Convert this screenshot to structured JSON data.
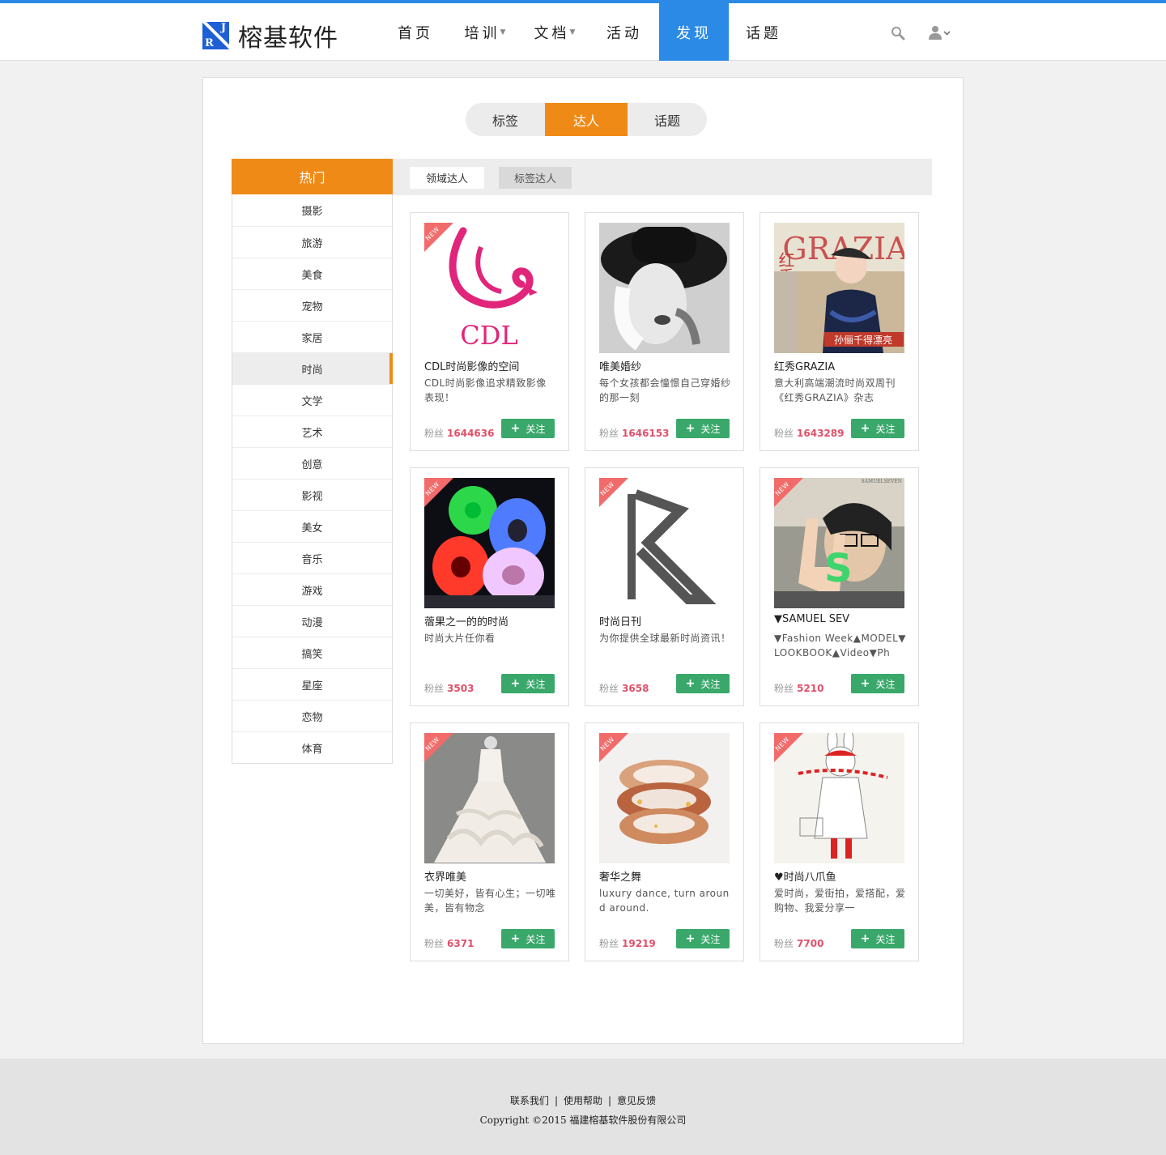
{
  "brand": {
    "name": "榕基软件",
    "mark_r": "R",
    "mark_j": "J"
  },
  "nav": [
    {
      "label": "首页",
      "dropdown": false
    },
    {
      "label": "培训",
      "dropdown": true
    },
    {
      "label": "文档",
      "dropdown": true
    },
    {
      "label": "活动",
      "dropdown": false
    },
    {
      "label": "发现",
      "dropdown": false,
      "active": true
    },
    {
      "label": "话题",
      "dropdown": false
    }
  ],
  "segment_tabs": [
    "标签",
    "达人",
    "话题"
  ],
  "segment_active": "达人",
  "sidebar": {
    "header": "热门",
    "items": [
      "摄影",
      "旅游",
      "美食",
      "宠物",
      "家居",
      "时尚",
      "文学",
      "艺术",
      "创意",
      "影视",
      "美女",
      "音乐",
      "游戏",
      "动漫",
      "搞笑",
      "星座",
      "恋物",
      "体育"
    ],
    "active": "时尚"
  },
  "sub_tabs": [
    "领域达人",
    "标签达人"
  ],
  "fans_label": "粉丝",
  "follow_label": "关注",
  "new_label": "NEW",
  "cards": [
    {
      "title": "CDL时尚影像的空间",
      "desc": "CDL时尚影像追求精致影像表现！",
      "fans": "1644636",
      "is_new": true,
      "image": "cdl-swan-logo",
      "logo_text": "CDL"
    },
    {
      "title": "唯美婚纱",
      "desc": "每个女孩都会憧憬自己穿婚纱的那一刻",
      "fans": "1646153",
      "is_new": false,
      "image": "woman-in-hat-bw"
    },
    {
      "title": "红秀GRAZIA",
      "desc": "意大利高端潮流时尚双周刊《红秀GRAZIA》杂志",
      "fans": "1643289",
      "is_new": false,
      "image": "grazia-magazine-cover",
      "cover_text": "GRAZIA",
      "cover_side": "红秀",
      "cover_caption": "孙俪千得漂亮"
    },
    {
      "title": "蓿果之一的的时尚",
      "desc": "时尚大片任你看",
      "fans": "3503",
      "is_new": true,
      "image": "led-light-reels"
    },
    {
      "title": "时尚日刊",
      "desc": "为你提供全球最新时尚资讯！",
      "fans": "3658",
      "is_new": true,
      "image": "text-letter-r"
    },
    {
      "title": "▼SAMUEL SEV",
      "desc": "▼Fashion Week▲MODEL▼LOOKBOOK▲Video▼Ph",
      "fans": "5210",
      "is_new": true,
      "image": "selfie-with-letter-s",
      "watermark": "SAMUELSEVEN"
    },
    {
      "title": "衣界唯美",
      "desc": "一切美好，皆有心生；一切唯美，皆有物念",
      "fans": "6371",
      "is_new": true,
      "image": "wedding-dress"
    },
    {
      "title": "奢华之舞",
      "desc": "luxury dance, turn around around.",
      "fans": "19219",
      "is_new": true,
      "image": "resin-rings"
    },
    {
      "title": "♥时尚八爪鱼",
      "desc": "爱时尚，爱街拍，爱搭配，爱购物、我爱分享一",
      "fans": "7700",
      "is_new": true,
      "image": "bunny-illustration"
    }
  ],
  "footer": {
    "links": [
      "联系我们",
      "使用帮助",
      "意见反馈"
    ],
    "copyright": "Copyright ©2015 福建榕基软件股份有限公司"
  },
  "colors": {
    "primary_blue": "#2a8ae6",
    "accent_orange": "#f08a17",
    "follow_green": "#3aa86b",
    "fans_red": "#e0506a",
    "badge_red": "#f26b6b"
  }
}
